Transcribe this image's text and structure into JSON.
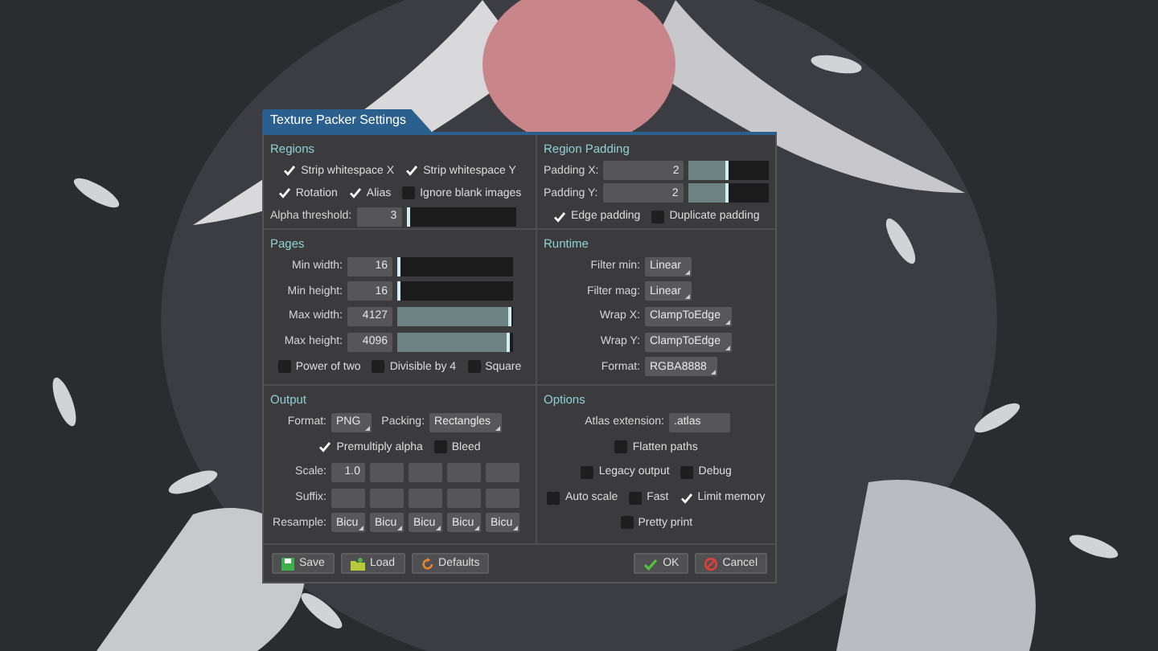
{
  "title": "Texture Packer Settings",
  "sections": [
    {
      "heading": "Regions",
      "rows": [
        {
          "kind": "checks",
          "items": [
            {
              "label": "Strip whitespace X",
              "checked": true
            },
            {
              "label": "Strip whitespace Y",
              "checked": true
            }
          ]
        },
        {
          "kind": "checks",
          "items": [
            {
              "label": "Rotation",
              "checked": true
            },
            {
              "label": "Alias",
              "checked": true
            },
            {
              "label": "Ignore blank images",
              "checked": false
            }
          ]
        },
        {
          "kind": "slider",
          "label": "Alpha threshold:",
          "value": "3",
          "level": 0.01
        }
      ]
    },
    {
      "heading": "Region Padding",
      "rows": [
        {
          "kind": "slider",
          "label": "Padding X:",
          "value": "2",
          "level": 0.5
        },
        {
          "kind": "slider",
          "label": "Padding Y:",
          "value": "2",
          "level": 0.5
        },
        {
          "kind": "checks",
          "items": [
            {
              "label": "Edge padding",
              "checked": true
            },
            {
              "label": "Duplicate padding",
              "checked": false
            }
          ]
        }
      ]
    },
    {
      "heading": "Pages",
      "rows": [
        {
          "kind": "slider",
          "label": "Min width:",
          "value": "16",
          "level": 0.01
        },
        {
          "kind": "slider",
          "label": "Min height:",
          "value": "16",
          "level": 0.01
        },
        {
          "kind": "slider",
          "label": "Max width:",
          "value": "4127",
          "level": 0.98
        },
        {
          "kind": "slider",
          "label": "Max height:",
          "value": "4096",
          "level": 0.97
        },
        {
          "kind": "checks",
          "items": [
            {
              "label": "Power of two",
              "checked": false
            },
            {
              "label": "Divisible by 4",
              "checked": false
            },
            {
              "label": "Square",
              "checked": false
            }
          ]
        }
      ]
    },
    {
      "heading": "Runtime",
      "rows": [
        {
          "kind": "select",
          "label": "Filter min:",
          "value": "Linear"
        },
        {
          "kind": "select",
          "label": "Filter mag:",
          "value": "Linear"
        },
        {
          "kind": "select",
          "label": "Wrap X:",
          "value": "ClampToEdge"
        },
        {
          "kind": "select",
          "label": "Wrap Y:",
          "value": "ClampToEdge"
        },
        {
          "kind": "select",
          "label": "Format:",
          "value": "RGBA8888"
        }
      ]
    },
    {
      "heading": "Output",
      "rows": [
        {
          "kind": "selects",
          "items": [
            {
              "label": "Format:",
              "value": "PNG"
            },
            {
              "label": "Packing:",
              "value": "Rectangles"
            }
          ]
        },
        {
          "kind": "checks",
          "items": [
            {
              "label": "Premultiply alpha",
              "checked": true
            },
            {
              "label": "Bleed",
              "checked": false
            }
          ]
        },
        {
          "kind": "grid",
          "label": "Scale:",
          "cells": [
            {
              "kind": "field",
              "value": "1.0"
            },
            {
              "kind": "field"
            },
            {
              "kind": "field"
            },
            {
              "kind": "field"
            },
            {
              "kind": "field"
            }
          ]
        },
        {
          "kind": "grid",
          "label": "Suffix:",
          "cells": [
            {
              "kind": "field"
            },
            {
              "kind": "field"
            },
            {
              "kind": "field"
            },
            {
              "kind": "field"
            },
            {
              "kind": "field"
            }
          ]
        },
        {
          "kind": "grid",
          "label": "Resample:",
          "cells": [
            {
              "kind": "select",
              "value": "Bicu"
            },
            {
              "kind": "select",
              "value": "Bicu"
            },
            {
              "kind": "select",
              "value": "Bicu"
            },
            {
              "kind": "select",
              "value": "Bicu"
            },
            {
              "kind": "select",
              "value": "Bicu"
            }
          ]
        }
      ]
    },
    {
      "heading": "Options",
      "rows": [
        {
          "kind": "field",
          "label": "Atlas extension:",
          "value": ".atlas"
        },
        {
          "kind": "checks",
          "items": [
            {
              "label": "Flatten paths",
              "checked": false
            }
          ]
        },
        {
          "kind": "checks",
          "items": [
            {
              "label": "Legacy output",
              "checked": false
            },
            {
              "label": "Debug",
              "checked": false
            }
          ]
        },
        {
          "kind": "checks",
          "items": [
            {
              "label": "Auto scale",
              "checked": false
            },
            {
              "label": "Fast",
              "checked": false
            },
            {
              "label": "Limit memory",
              "checked": true
            }
          ]
        },
        {
          "kind": "checks",
          "items": [
            {
              "label": "Pretty print",
              "checked": false
            }
          ]
        }
      ]
    }
  ],
  "left_buttons": [
    {
      "label": "Save",
      "kind": "save"
    },
    {
      "label": "Load",
      "kind": "load"
    },
    {
      "label": "Defaults",
      "kind": "defaults"
    }
  ],
  "right_buttons": [
    {
      "label": "OK",
      "kind": "ok"
    },
    {
      "label": "Cancel",
      "kind": "cancel"
    }
  ]
}
